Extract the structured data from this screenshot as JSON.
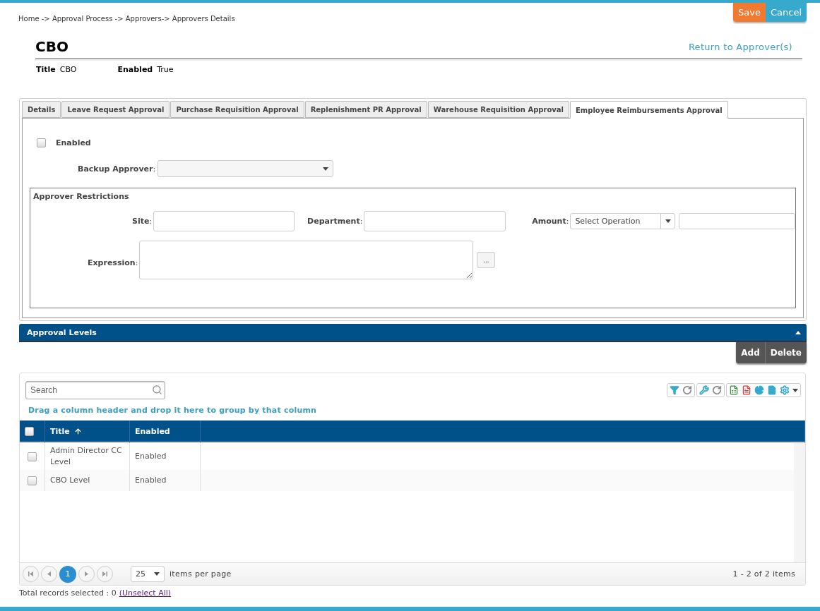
{
  "actions": [
    {
      "label": "Save",
      "kind": "save"
    },
    {
      "label": "Cancel",
      "kind": "cancel"
    }
  ],
  "breadcrumb": "Home -> Approval Process -> Approvers-> Approvers Details",
  "header": {
    "title": "CBO",
    "return_link": "Return to Approver(s)"
  },
  "meta": [
    {
      "label": "Title",
      "value": "CBO"
    },
    {
      "label": "Enabled",
      "value": "True"
    }
  ],
  "tabs": [
    {
      "label": "Details",
      "selected": false
    },
    {
      "label": "Leave Request Approval",
      "selected": false
    },
    {
      "label": "Purchase Requisition Approval",
      "selected": false
    },
    {
      "label": "Replenishment PR Approval",
      "selected": false
    },
    {
      "label": "Warehouse Requisition Approval",
      "selected": false
    },
    {
      "label": "Employee Reimbursements Approval",
      "selected": true
    }
  ],
  "form": {
    "enabled": {
      "label": "Enabled",
      "checked": false
    },
    "backup_approver": {
      "label": "**Backup Approver**:"
    },
    "restrictions": {
      "title": "Approver Restrictions",
      "site_label": "**Site**:",
      "department_label": "**Department**:",
      "amount_label": "**Amount**:",
      "operation_placeholder": "Select Operation",
      "expression_label": "**Expression**:",
      "expression_button": "..."
    }
  },
  "panel": {
    "title": "Approval Levels",
    "expanded": true
  },
  "grid_actions": [
    "Add",
    "Delete"
  ],
  "grid": {
    "search_placeholder": "Search",
    "group_hint": "Drag a column header and drop it here to group by that column",
    "header_checked": false,
    "columns": [
      {
        "label": "Title",
        "sorted": true
      },
      {
        "label": "Enabled",
        "sorted": false
      }
    ],
    "rows": [
      {
        "title": "Admin Director CC Level",
        "enabled": "Enabled",
        "checked": false
      },
      {
        "title": "CBO Level",
        "enabled": "Enabled",
        "checked": false
      }
    ],
    "pager": {
      "pages": [
        {
          "label": "1",
          "selected": true
        }
      ],
      "page_size": "25",
      "page_size_label": "items per page",
      "summary": "1 - 2 of 2 items"
    }
  },
  "footer": {
    "text": "Total records selected : 0",
    "link": "(Unselect All)"
  }
}
